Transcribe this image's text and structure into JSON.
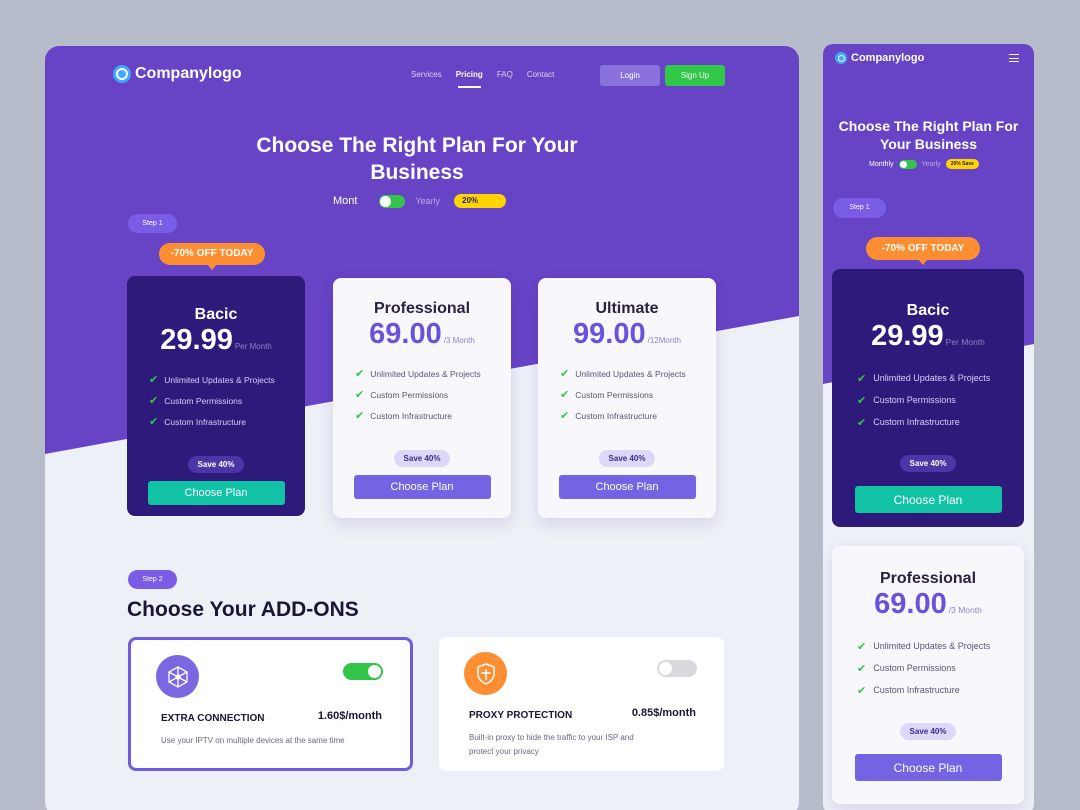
{
  "brand": {
    "name": "Companylogo",
    "accent": "#6744c6",
    "success": "#31c748",
    "teal": "#11c2a4",
    "orange": "#fd8e32",
    "yellow": "#ffd400"
  },
  "nav": {
    "links": [
      "Services",
      "Pricing",
      "FAQ",
      "Contact"
    ],
    "active": "Pricing",
    "login": "Login",
    "signup": "Sign Up"
  },
  "hero": {
    "title": "Choose The Right Plan For Your Business",
    "monthly": "Mont",
    "yearly": "Yearly",
    "discount": "20%"
  },
  "step1": "Step 1",
  "offer": "-70% OFF TODAY",
  "features": [
    "Unlimited Updates & Projects",
    "Custom Permissions",
    "Custom Infrastructure"
  ],
  "plans": [
    {
      "name": "Bacic",
      "price": "29.99",
      "period": "Per Month",
      "save": "Save 40%",
      "cta": "Choose Plan",
      "highlighted": true
    },
    {
      "name": "Professional",
      "price": "69.00",
      "period": "/3 Month",
      "save": "Save 40%",
      "cta": "Choose Plan",
      "highlighted": false
    },
    {
      "name": "Ultimate",
      "price": "99.00",
      "period": "/12Month",
      "save": "Save 40%",
      "cta": "Choose Plan",
      "highlighted": false
    }
  ],
  "step2": "Step 2",
  "addons": {
    "title": "Choose Your ADD-ONS",
    "items": [
      {
        "name": "EXTRA CONNECTION",
        "price": "1.60$/month",
        "desc": "Use your IPTV on multiple devices at the same time",
        "enabled": true,
        "icon": "network-icon",
        "icon_color": "#7c67e3"
      },
      {
        "name": "PROXY PROTECTION",
        "price": "0.85$/month",
        "desc": "Built-in proxy to hide the traffic to your ISP and protect your privacy",
        "enabled": false,
        "icon": "shield-icon",
        "icon_color": "#fd8e32"
      }
    ]
  },
  "mobile": {
    "title": "Choose The Right Plan For Your Business",
    "monthly": "Monthly",
    "yearly": "Yearly",
    "discount": "20% Save"
  }
}
